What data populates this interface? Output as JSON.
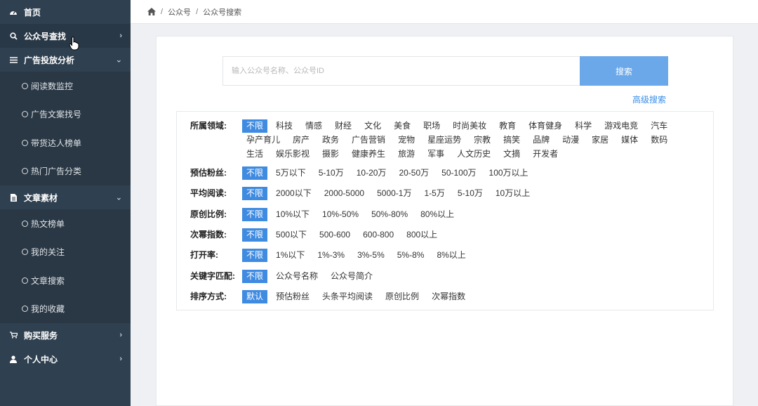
{
  "sidebar": {
    "home": "首页",
    "wechat_search": "公众号查找",
    "ad_analysis": "广告投放分析",
    "ad_sub": [
      "阅读数监控",
      "广告文案找号",
      "带货达人榜单",
      "热门广告分类"
    ],
    "article_material": "文章素材",
    "article_sub": [
      "热文榜单",
      "我的关注",
      "文章搜索",
      "我的收藏"
    ],
    "buy_service": "购买服务",
    "user_center": "个人中心"
  },
  "breadcrumb": {
    "level1": "公众号",
    "level2": "公众号搜索",
    "sep": "/"
  },
  "search": {
    "placeholder": "输入公众号名称、公众号ID",
    "value": "",
    "button": "搜索",
    "advanced": "高级搜索"
  },
  "filters": [
    {
      "label": "所属领域:",
      "selected": 0,
      "options": [
        "不限",
        "科技",
        "情感",
        "财经",
        "文化",
        "美食",
        "职场",
        "时尚美妆",
        "教育",
        "体育健身",
        "科学",
        "游戏电竞",
        "汽车",
        "孕产育儿",
        "房产",
        "政务",
        "广告营销",
        "宠物",
        "星座运势",
        "宗教",
        "搞笑",
        "品牌",
        "动漫",
        "家居",
        "媒体",
        "数码",
        "生活",
        "娱乐影视",
        "摄影",
        "健康养生",
        "旅游",
        "军事",
        "人文历史",
        "文摘",
        "开发者"
      ]
    },
    {
      "label": "预估粉丝:",
      "selected": 0,
      "options": [
        "不限",
        "5万以下",
        "5-10万",
        "10-20万",
        "20-50万",
        "50-100万",
        "100万以上"
      ]
    },
    {
      "label": "平均阅读:",
      "selected": 0,
      "options": [
        "不限",
        "2000以下",
        "2000-5000",
        "5000-1万",
        "1-5万",
        "5-10万",
        "10万以上"
      ]
    },
    {
      "label": "原创比例:",
      "selected": 0,
      "options": [
        "不限",
        "10%以下",
        "10%-50%",
        "50%-80%",
        "80%以上"
      ]
    },
    {
      "label": "次幂指数:",
      "selected": 0,
      "options": [
        "不限",
        "500以下",
        "500-600",
        "600-800",
        "800以上"
      ]
    },
    {
      "label": "打开率:",
      "selected": 0,
      "options": [
        "不限",
        "1%以下",
        "1%-3%",
        "3%-5%",
        "5%-8%",
        "8%以上"
      ]
    },
    {
      "label": "关键字匹配:",
      "selected": 0,
      "options": [
        "不限",
        "公众号名称",
        "公众号简介"
      ]
    },
    {
      "label": "排序方式:",
      "selected": 0,
      "options": [
        "默认",
        "预估粉丝",
        "头条平均阅读",
        "原创比例",
        "次幂指数"
      ]
    }
  ],
  "colors": {
    "sidebar_bg": "#2f4050",
    "accent": "#3f8be1",
    "search_button": "#6aa8ea",
    "link": "#3a8ee6"
  }
}
